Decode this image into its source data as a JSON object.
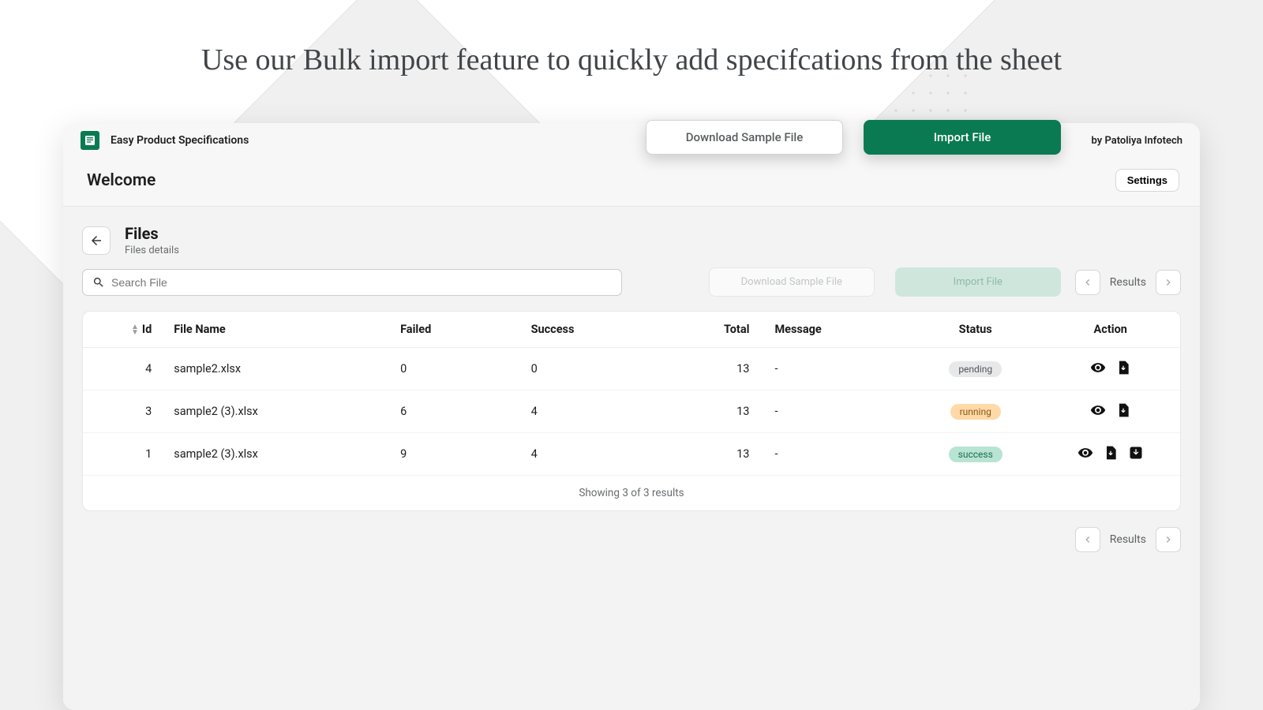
{
  "headline": "Use our Bulk import feature to quickly add specifcations from the sheet",
  "app": {
    "name": "Easy Product Specifications",
    "byline": "by Patoliya Infotech"
  },
  "welcome": {
    "title": "Welcome",
    "settings_label": "Settings"
  },
  "files": {
    "title": "Files",
    "subtitle": "Files details"
  },
  "search": {
    "placeholder": "Search File"
  },
  "actions": {
    "download_sample": "Download Sample File",
    "import_file": "Import File"
  },
  "ghost_actions": {
    "download_sample": "Download Sample File",
    "import_file": "Import File"
  },
  "pager": {
    "results_label": "Results"
  },
  "table": {
    "headers": {
      "id": "Id",
      "file_name": "File Name",
      "failed": "Failed",
      "success": "Success",
      "total": "Total",
      "message": "Message",
      "status": "Status",
      "action": "Action"
    },
    "rows": [
      {
        "id": "4",
        "file_name": "sample2.xlsx",
        "failed": "0",
        "success": "0",
        "total": "13",
        "message": "-",
        "status": "pending",
        "status_label": "pending",
        "actions": [
          "view",
          "download"
        ]
      },
      {
        "id": "3",
        "file_name": "sample2 (3).xlsx",
        "failed": "6",
        "success": "4",
        "total": "13",
        "message": "-",
        "status": "running",
        "status_label": "running",
        "actions": [
          "view",
          "download"
        ]
      },
      {
        "id": "1",
        "file_name": "sample2 (3).xlsx",
        "failed": "9",
        "success": "4",
        "total": "13",
        "message": "-",
        "status": "success",
        "status_label": "success",
        "actions": [
          "view",
          "download",
          "download2"
        ]
      }
    ],
    "footer": "Showing 3 of 3 results"
  }
}
